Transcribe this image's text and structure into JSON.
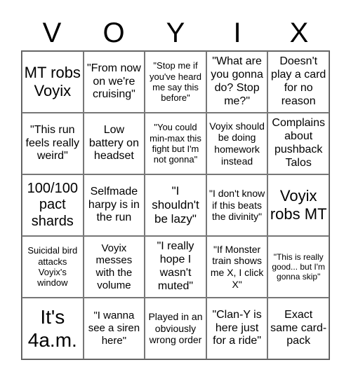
{
  "title_letters": [
    "V",
    "O",
    "Y",
    "I",
    "X"
  ],
  "cells": [
    "MT robs Voyix",
    "\"From now on we're cruising\"",
    "\"Stop me if you've heard me say this before\"",
    "\"What are you gonna do? Stop me?\"",
    "Doesn't play a card for no reason",
    "\"This run feels really weird\"",
    "Low battery on headset",
    "\"You could min-max this fight but I'm not gonna\"",
    "Voyix should be doing homework instead",
    "Complains about pushback Talos",
    "100/100 pact shards",
    "Selfmade harpy is in the run",
    "\"I shouldn't be lazy\"",
    "\"I don't know if this beats the divinity\"",
    "Voyix robs MT",
    "Suicidal bird attacks Voyix's window",
    "Voyix messes with the volume",
    "\"I really hope I wasn't muted\"",
    "\"If Monster train shows me X, I click X\"",
    "\"This is really good... but I'm gonna skip\"",
    "It's 4a.m.",
    "\"I wanna see a siren here\"",
    "Played in an obviously wrong order",
    "\"Clan-Y is here just for a ride\"",
    "Exact same card-pack"
  ]
}
